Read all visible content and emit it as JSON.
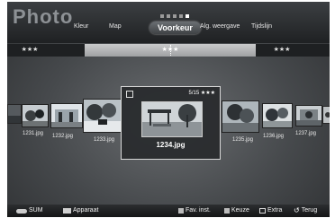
{
  "app": {
    "title": "Photo"
  },
  "tabs": [
    {
      "label": "Kleur"
    },
    {
      "label": "Map"
    },
    {
      "label": "Voorkeur",
      "selected": true
    },
    {
      "label": "Alg. weergave"
    },
    {
      "label": "Tijdslijn"
    }
  ],
  "rating_bar": {
    "left": "★★★",
    "center": "★★★",
    "right": "★★★"
  },
  "photos": [
    {
      "name": "1231.jpg"
    },
    {
      "name": "1232.jpg"
    },
    {
      "name": "1233.jpg"
    },
    {
      "name": "1234.jpg",
      "selected": true
    },
    {
      "name": "1235.jpg"
    },
    {
      "name": "1236.jpg"
    },
    {
      "name": "1237.jpg"
    }
  ],
  "focus": {
    "name": "1234.jpg",
    "counter": "5/15 ★★★"
  },
  "footer": {
    "sum": "SUM",
    "device": "Apparaat",
    "fav": "Fav. inst.",
    "select": "Keuze",
    "extra": "Extra",
    "back": "Terug"
  },
  "colors": {
    "accent": "#ffffff",
    "background": "#4a4d50"
  }
}
